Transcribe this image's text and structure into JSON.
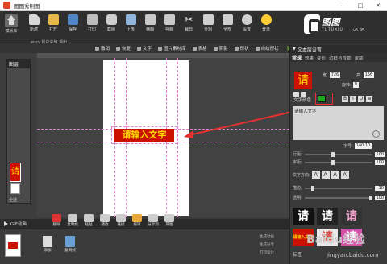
{
  "window": {
    "title": "图图秀制图",
    "controls": [
      "—",
      "□",
      "✕"
    ]
  },
  "toolbar": {
    "home_label": "模板库",
    "account_line": "ency 账户充值 退出",
    "tools": [
      {
        "label": "新建",
        "icon": "new-doc-icon"
      },
      {
        "label": "打开",
        "icon": "folder-icon"
      },
      {
        "label": "保存",
        "icon": "save-icon"
      },
      {
        "label": "打印",
        "icon": "print-icon"
      },
      {
        "label": "截图",
        "icon": "camera-icon"
      },
      {
        "label": "上传",
        "icon": "upload-icon"
      },
      {
        "label": "横翻",
        "icon": "flip-h-icon"
      },
      {
        "label": "竖翻",
        "icon": "flip-v-icon"
      },
      {
        "label": "裁剪",
        "icon": "scissors-icon"
      },
      {
        "label": "分割",
        "icon": "split-icon"
      },
      {
        "label": "全部",
        "icon": "select-all-icon"
      },
      {
        "label": "设置",
        "icon": "gear-icon"
      },
      {
        "label": "登录",
        "icon": "smile-icon"
      }
    ],
    "logo_name": "图图",
    "logo_sub": "TUTUXIU",
    "logo_version": "v5.95"
  },
  "subtoolbar": {
    "items": [
      "撤销",
      "恢复",
      "文字",
      "图片素材库",
      "表格",
      "阴影",
      "形状",
      "自绘形状"
    ],
    "more": "更多"
  },
  "layers": {
    "title": "图层",
    "thumb_text": "请",
    "all_label": "全选"
  },
  "canvas": {
    "placeholder_text": "请输入文字"
  },
  "right_panel": {
    "header": "文本层设置",
    "tabs": [
      "常规",
      "效果",
      "变形",
      "边框与背景",
      "蒙版"
    ],
    "preview_char": "请",
    "width_label": "宽:",
    "width_value": "726",
    "height_label": "高:",
    "height_value": "156",
    "rotate_label": "旋转:",
    "rotate_value": "0",
    "color_label": "文字颜色",
    "format_buttons": [
      "B",
      "I",
      "U",
      "≡"
    ],
    "textarea_text": "请输入文字",
    "font_size_label": "字号:",
    "font_size_value": "140.10",
    "line_spacing_label": "行距:",
    "line_spacing_value": "100",
    "char_spacing_label": "字距:",
    "char_spacing_value": "100",
    "direction_label": "文字方向:",
    "direction_buttons": [
      "A",
      "A",
      "A",
      "A"
    ],
    "outline_label": "描边:",
    "outline_value": "10",
    "opacity_label": "透明:",
    "opacity_value": "100",
    "styles": [
      "请",
      "请",
      "请",
      "请输入文字",
      "请",
      "请"
    ],
    "tag_label": "标签"
  },
  "bottom": {
    "gif_label": "GIF动画",
    "anim_tools": [
      "删除",
      "复制帧",
      "粘贴",
      "播放",
      "链接",
      "编辑",
      "分享到",
      "属性"
    ],
    "frame_tools": [
      "添加",
      "复制帧"
    ],
    "right_list": [
      "生成动画",
      "生成分享",
      "打印设计"
    ],
    "watermark": "Baidu经验",
    "watermark_url": "jingyan.baidu.com"
  },
  "colors": {
    "accent_red": "#cc1100",
    "text_yellow": "#ffd800",
    "swatch_green": "#1fa81f",
    "guide_pink": "#e07fd5",
    "annotation_red": "#e53030",
    "more_green": "#8fd14f"
  }
}
